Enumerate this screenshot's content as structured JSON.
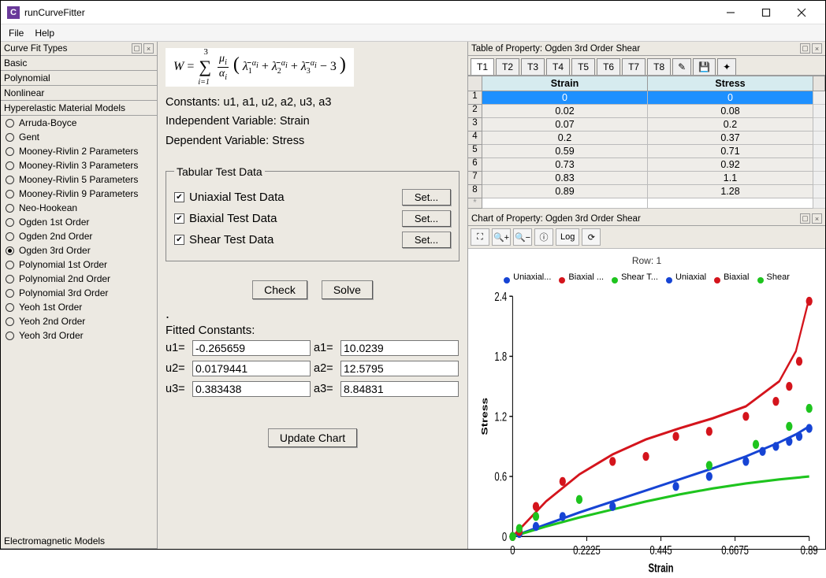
{
  "window": {
    "title": "runCurveFitter",
    "icon_letter": "C"
  },
  "menu": {
    "file": "File",
    "help": "Help"
  },
  "sidebar": {
    "title": "Curve Fit Types",
    "sections": {
      "basic": "Basic",
      "polynomial": "Polynomial",
      "nonlinear": "Nonlinear",
      "hyper": "Hyperelastic Material Models",
      "electro": "Electromagnetic Models"
    },
    "items": [
      "Arruda-Boyce",
      "Gent",
      "Mooney-Rivlin 2 Parameters",
      "Mooney-Rivlin 3 Parameters",
      "Mooney-Rivlin 5 Parameters",
      "Mooney-Rivlin 9 Parameters",
      "Neo-Hookean",
      "Ogden 1st Order",
      "Ogden 2nd Order",
      "Ogden 3rd Order",
      "Polynomial 1st Order",
      "Polynomial 2nd Order",
      "Polynomial 3rd Order",
      "Yeoh 1st Order",
      "Yeoh 2nd Order",
      "Yeoh 3rd Order"
    ],
    "selected_index": 9
  },
  "center": {
    "constants_label": "Constants: u1, a1, u2, a2, u3, a3",
    "indep_label": "Independent Variable: Strain",
    "dep_label": "Dependent Variable: Stress",
    "ttd_legend": "Tabular Test Data",
    "ttd_rows": [
      {
        "label": "Uniaxial Test Data",
        "button": "Set..."
      },
      {
        "label": "Biaxial Test Data",
        "button": "Set..."
      },
      {
        "label": "Shear Test Data",
        "button": "Set..."
      }
    ],
    "check_label": "Check",
    "solve_label": "Solve",
    "fitted_title": "Fitted Constants:",
    "fc": {
      "u1": "-0.265659",
      "a1": "10.0239",
      "u2": "0.0179441",
      "a2": "12.5795",
      "u3": "0.383438",
      "a3": "8.84831"
    },
    "update_label": "Update Chart"
  },
  "table": {
    "title": "Table of Property: Ogden 3rd Order Shear",
    "tabs": [
      "T1",
      "T2",
      "T3",
      "T4",
      "T5",
      "T6",
      "T7",
      "T8"
    ],
    "headers": {
      "strain": "Strain",
      "stress": "Stress"
    },
    "rows": [
      {
        "strain": "0",
        "stress": "0"
      },
      {
        "strain": "0.02",
        "stress": "0.08"
      },
      {
        "strain": "0.07",
        "stress": "0.2"
      },
      {
        "strain": "0.2",
        "stress": "0.37"
      },
      {
        "strain": "0.59",
        "stress": "0.71"
      },
      {
        "strain": "0.73",
        "stress": "0.92"
      },
      {
        "strain": "0.83",
        "stress": "1.1"
      },
      {
        "strain": "0.89",
        "stress": "1.28"
      }
    ]
  },
  "chart": {
    "title": "Chart of Property: Ogden 3rd Order Shear",
    "row_label": "Row: 1",
    "log_label": "Log",
    "legend": [
      "Uniaxial...",
      "Biaxial ...",
      "Shear T...",
      "Uniaxial",
      "Biaxial",
      "Shear"
    ],
    "colors": {
      "uni": "#1644d4",
      "bi": "#d4141c",
      "shear": "#1ec41e"
    },
    "xlabel": "Strain",
    "ylabel": "Stress"
  },
  "chart_data": {
    "type": "scatter+line",
    "xlabel": "Strain",
    "ylabel": "Stress",
    "xlim": [
      0,
      0.89
    ],
    "ylim": [
      0,
      2.4
    ],
    "xticks": [
      0,
      0.2225,
      0.445,
      0.6675,
      0.89
    ],
    "yticks": [
      0,
      0.6,
      1.2,
      1.8,
      2.4
    ],
    "series_points": [
      {
        "name": "Uniaxial",
        "color": "#1644d4",
        "x": [
          0,
          0.02,
          0.07,
          0.15,
          0.3,
          0.49,
          0.59,
          0.7,
          0.75,
          0.79,
          0.83,
          0.86,
          0.89
        ],
        "y": [
          0,
          0.03,
          0.1,
          0.2,
          0.3,
          0.5,
          0.6,
          0.75,
          0.85,
          0.9,
          0.95,
          1.0,
          1.08
        ]
      },
      {
        "name": "Biaxial",
        "color": "#d4141c",
        "x": [
          0,
          0.02,
          0.07,
          0.15,
          0.3,
          0.4,
          0.49,
          0.59,
          0.7,
          0.79,
          0.83,
          0.86,
          0.89
        ],
        "y": [
          0,
          0.05,
          0.3,
          0.55,
          0.75,
          0.8,
          1.0,
          1.05,
          1.2,
          1.35,
          1.5,
          1.75,
          2.35
        ]
      },
      {
        "name": "Shear",
        "color": "#1ec41e",
        "x": [
          0,
          0.02,
          0.07,
          0.2,
          0.59,
          0.73,
          0.83,
          0.89
        ],
        "y": [
          0,
          0.08,
          0.2,
          0.37,
          0.71,
          0.92,
          1.1,
          1.28
        ]
      }
    ],
    "series_lines": [
      {
        "name": "Uniaxial fit",
        "color": "#1644d4",
        "x": [
          0,
          0.1,
          0.2,
          0.3,
          0.4,
          0.5,
          0.6,
          0.7,
          0.8,
          0.85,
          0.89
        ],
        "y": [
          0,
          0.12,
          0.24,
          0.35,
          0.46,
          0.57,
          0.68,
          0.8,
          0.94,
          1.02,
          1.1
        ]
      },
      {
        "name": "Biaxial fit",
        "color": "#d4141c",
        "x": [
          0,
          0.1,
          0.2,
          0.3,
          0.4,
          0.5,
          0.6,
          0.7,
          0.8,
          0.85,
          0.89
        ],
        "y": [
          0,
          0.35,
          0.62,
          0.82,
          0.97,
          1.08,
          1.18,
          1.3,
          1.55,
          1.85,
          2.38
        ]
      },
      {
        "name": "Shear fit",
        "color": "#1ec41e",
        "x": [
          0,
          0.1,
          0.2,
          0.3,
          0.4,
          0.5,
          0.6,
          0.7,
          0.8,
          0.89
        ],
        "y": [
          0,
          0.1,
          0.19,
          0.27,
          0.35,
          0.42,
          0.48,
          0.53,
          0.57,
          0.6
        ]
      }
    ]
  }
}
